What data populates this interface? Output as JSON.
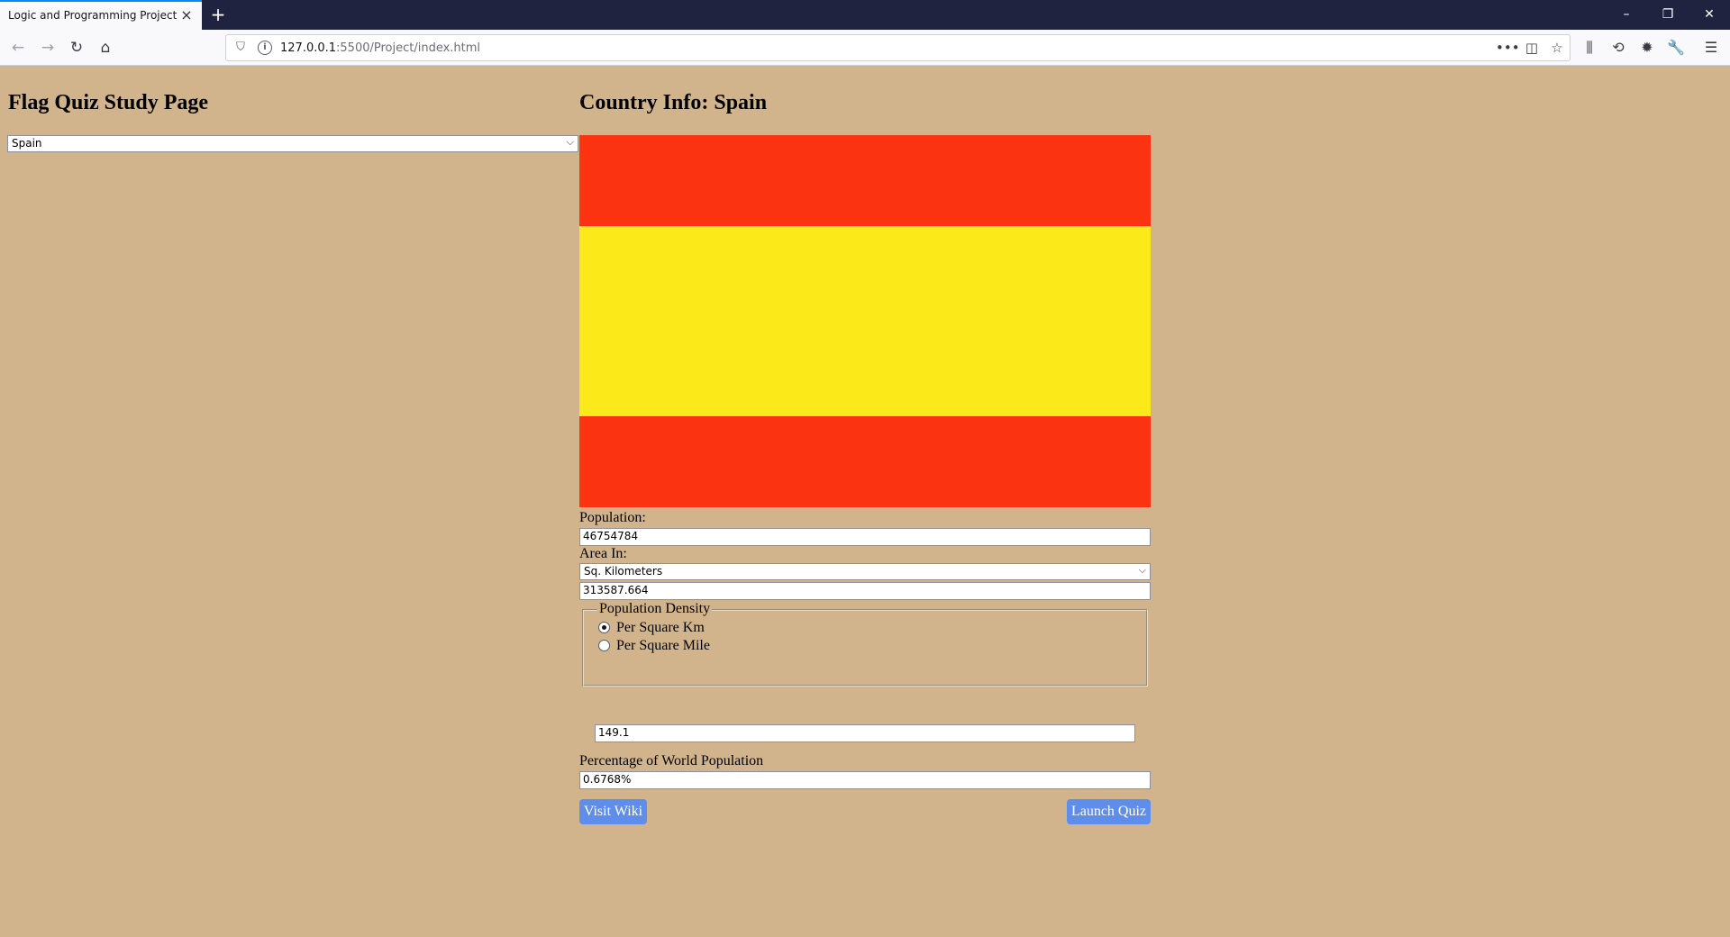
{
  "browser": {
    "tab_title": "Logic and Programming Project",
    "tab_close_icon": "×",
    "new_tab_icon": "+",
    "url_host": "127.0.0.1",
    "url_rest": ":5500/Project/index.html",
    "window_controls": [
      "–",
      "❐",
      "✕"
    ]
  },
  "page": {
    "left_title": "Flag Quiz Study Page",
    "country_select_value": "Spain",
    "right_title": "Country Info: Spain",
    "flag": {
      "stripe_colors": [
        "#fc3311",
        "#fbe919",
        "#fc3311"
      ]
    },
    "population_label": "Population:",
    "population_value": "46754784",
    "area_label": "Area In:",
    "area_unit_value": "Sq. Kilometers",
    "area_value": "313587.664",
    "density": {
      "legend": "Population Density",
      "option_km": "Per Square Km",
      "option_mile": "Per Square Mile",
      "selected": "Per Square Km",
      "value": "149.1"
    },
    "world_pct_label": "Percentage of World Population",
    "world_pct_value": "0.6768%",
    "visit_wiki_label": "Visit Wiki",
    "launch_quiz_label": "Launch Quiz"
  },
  "colors": {
    "page_background": "#d2b48c",
    "button": "#5f8dea"
  }
}
